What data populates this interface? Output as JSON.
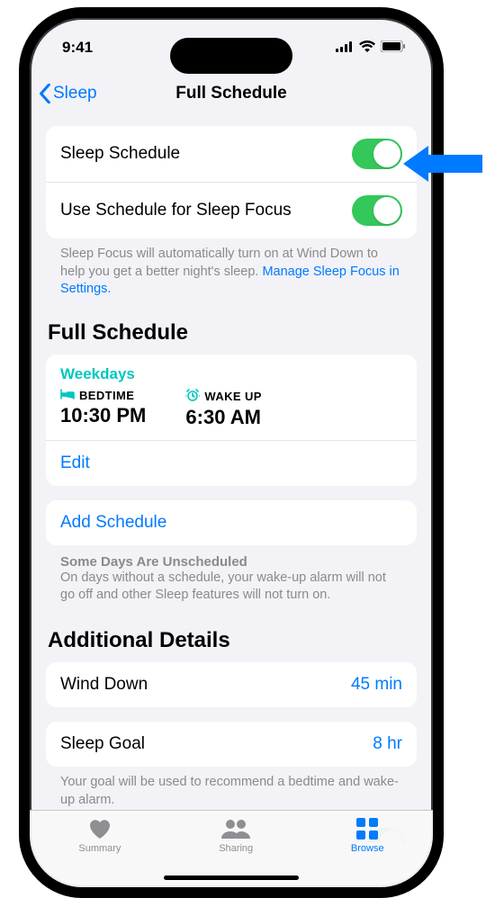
{
  "status": {
    "time": "9:41"
  },
  "nav": {
    "back_label": "Sleep",
    "title": "Full Schedule"
  },
  "toggles": {
    "sleep_schedule_label": "Sleep Schedule",
    "use_schedule_label": "Use Schedule for Sleep Focus",
    "footer": "Sleep Focus will automatically turn on at Wind Down to help you get a better night's sleep. ",
    "footer_link": "Manage Sleep Focus in Settings."
  },
  "schedule": {
    "section_title": "Full Schedule",
    "period": "Weekdays",
    "bedtime_label": "BEDTIME",
    "bedtime_value": "10:30 PM",
    "wakeup_label": "WAKE UP",
    "wakeup_value": "6:30 AM",
    "edit_label": "Edit",
    "add_label": "Add Schedule",
    "unscheduled_title": "Some Days Are Unscheduled",
    "unscheduled_body": "On days without a schedule, your wake-up alarm will not go off and other Sleep features will not turn on."
  },
  "details": {
    "section_title": "Additional Details",
    "wind_down_label": "Wind Down",
    "wind_down_value": "45 min",
    "sleep_goal_label": "Sleep Goal",
    "sleep_goal_value": "8 hr",
    "goal_note": "Your goal will be used to recommend a bedtime and wake-up alarm."
  },
  "tabs": {
    "summary": "Summary",
    "sharing": "Sharing",
    "browse": "Browse"
  }
}
